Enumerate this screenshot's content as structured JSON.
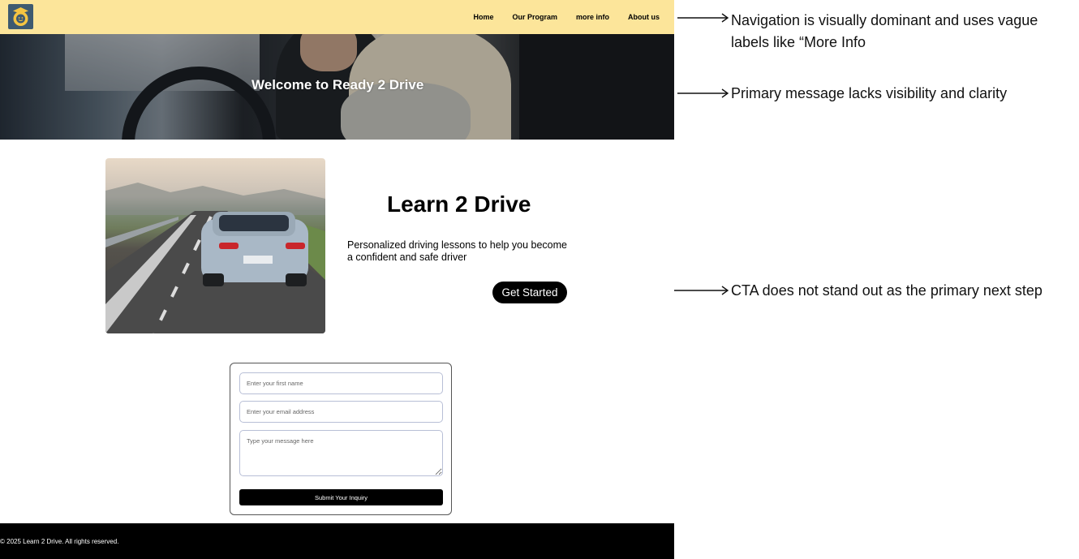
{
  "nav": {
    "links": [
      "Home",
      "Our Program",
      "more info",
      "About us"
    ]
  },
  "hero": {
    "title": "Welcome to Ready 2 Drive"
  },
  "intro": {
    "title": "Learn 2 Drive",
    "description": "Personalized driving lessons to help you become a confident and safe driver",
    "cta_label": "Get Started"
  },
  "form": {
    "first_name_placeholder": "Enter your first name",
    "email_placeholder": "Enter your email address",
    "message_placeholder": "Type your message here",
    "submit_label": "Submit Your Inquiry"
  },
  "footer": {
    "text": "© 2025 Learn 2 Drive. All rights reserved."
  },
  "annotations": [
    "Navigation is visually dominant and uses vague labels like “More Info",
    "Primary message lacks visibility and clarity",
    "CTA does not stand out as the primary next step"
  ],
  "colors": {
    "navbar": "#fce59a",
    "cta": "#000000",
    "footer": "#000000"
  }
}
